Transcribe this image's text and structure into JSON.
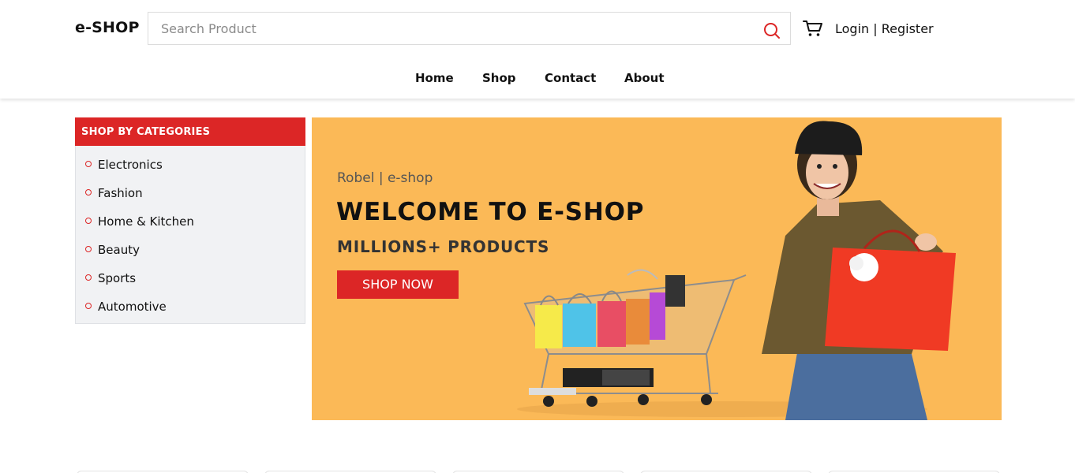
{
  "header": {
    "logo": "e-SHOP",
    "search_placeholder": "Search Product",
    "auth_login": "Login",
    "auth_sep": " | ",
    "auth_register": "Register"
  },
  "nav": {
    "items": [
      "Home",
      "Shop",
      "Contact",
      "About"
    ]
  },
  "sidebar": {
    "title": "SHOP BY CATEGORIES",
    "items": [
      "Electronics",
      "Fashion",
      "Home & Kitchen",
      "Beauty",
      "Sports",
      "Automotive"
    ]
  },
  "banner": {
    "subtitle": "Robel | e-shop",
    "title": "WELCOME TO E-SHOP",
    "tagline": "MILLIONS+ PRODUCTS",
    "button": "SHOP NOW"
  },
  "colors": {
    "accent": "#dc2626",
    "banner_bg": "#fbb957",
    "sidebar_bg": "#f1f2f4"
  }
}
